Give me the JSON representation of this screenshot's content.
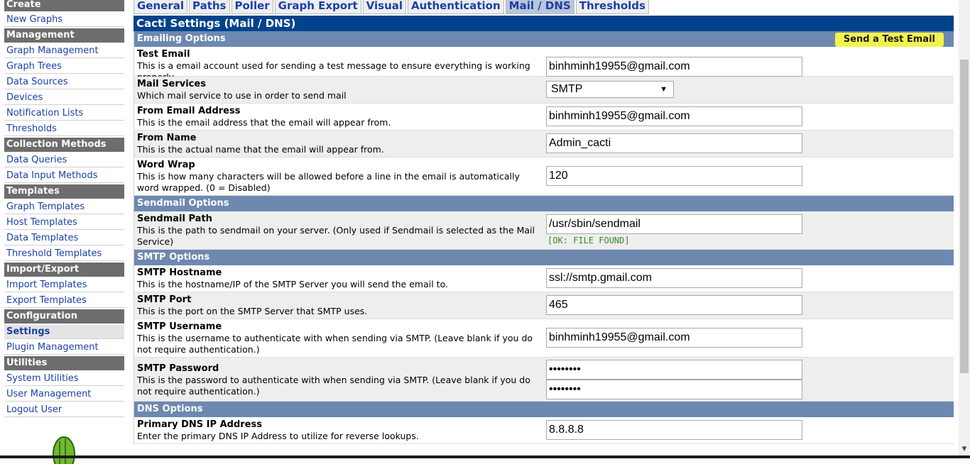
{
  "sidebar": {
    "create_label": "Create",
    "items": [
      {
        "type": "item",
        "label": "New Graphs"
      },
      {
        "type": "header",
        "label": "Management"
      },
      {
        "type": "item",
        "label": "Graph Management"
      },
      {
        "type": "item",
        "label": "Graph Trees"
      },
      {
        "type": "item",
        "label": "Data Sources"
      },
      {
        "type": "item",
        "label": "Devices"
      },
      {
        "type": "item",
        "label": "Notification Lists"
      },
      {
        "type": "item",
        "label": "Thresholds"
      },
      {
        "type": "header",
        "label": "Collection Methods"
      },
      {
        "type": "item",
        "label": "Data Queries"
      },
      {
        "type": "item",
        "label": "Data Input Methods"
      },
      {
        "type": "header",
        "label": "Templates"
      },
      {
        "type": "item",
        "label": "Graph Templates"
      },
      {
        "type": "item",
        "label": "Host Templates"
      },
      {
        "type": "item",
        "label": "Data Templates"
      },
      {
        "type": "item",
        "label": "Threshold Templates"
      },
      {
        "type": "header",
        "label": "Import/Export"
      },
      {
        "type": "item",
        "label": "Import Templates"
      },
      {
        "type": "item",
        "label": "Export Templates"
      },
      {
        "type": "header",
        "label": "Configuration"
      },
      {
        "type": "item",
        "label": "Settings",
        "selected": true
      },
      {
        "type": "item",
        "label": "Plugin Management"
      },
      {
        "type": "header",
        "label": "Utilities"
      },
      {
        "type": "item",
        "label": "System Utilities"
      },
      {
        "type": "item",
        "label": "User Management"
      },
      {
        "type": "item",
        "label": "Logout User"
      }
    ]
  },
  "tabs": [
    {
      "label": "General",
      "active": false
    },
    {
      "label": "Paths",
      "active": false
    },
    {
      "label": "Poller",
      "active": false
    },
    {
      "label": "Graph Export",
      "active": false
    },
    {
      "label": "Visual",
      "active": false
    },
    {
      "label": "Authentication",
      "active": false
    },
    {
      "label": "Mail / DNS",
      "active": true
    },
    {
      "label": "Thresholds",
      "active": false
    }
  ],
  "page_title": "Cacti Settings (Mail / DNS)",
  "sections": {
    "emailing": {
      "title": "Emailing Options",
      "test_button": "Send a Test Email"
    },
    "sendmail": {
      "title": "Sendmail Options"
    },
    "smtp": {
      "title": "SMTP Options"
    },
    "dns": {
      "title": "DNS Options"
    }
  },
  "fields": {
    "test_email": {
      "title": "Test Email",
      "desc": "This is a email account used for sending a test message to ensure everything is working properly.",
      "value": "binhminh19955@gmail.com"
    },
    "mail_services": {
      "title": "Mail Services",
      "desc": "Which mail service to use in order to send mail",
      "value": "SMTP"
    },
    "from_email": {
      "title": "From Email Address",
      "desc": "This is the email address that the email will appear from.",
      "value": "binhminh19955@gmail.com"
    },
    "from_name": {
      "title": "From Name",
      "desc": "This is the actual name that the email will appear from.",
      "value": "Admin_cacti"
    },
    "word_wrap": {
      "title": "Word Wrap",
      "desc": "This is how many characters will be allowed before a line in the email is automatically word wrapped. (0 = Disabled)",
      "value": "120"
    },
    "sendmail_path": {
      "title": "Sendmail Path",
      "desc": "This is the path to sendmail on your server. (Only used if Sendmail is selected as the Mail Service)",
      "value": "/usr/sbin/sendmail",
      "status": "[OK: FILE FOUND]"
    },
    "smtp_hostname": {
      "title": "SMTP Hostname",
      "desc": "This is the hostname/IP of the SMTP Server you will send the email to.",
      "value": "ssl://smtp.gmail.com"
    },
    "smtp_port": {
      "title": "SMTP Port",
      "desc": "This is the port on the SMTP Server that SMTP uses.",
      "value": "465"
    },
    "smtp_username": {
      "title": "SMTP Username",
      "desc": "This is the username to authenticate with when sending via SMTP. (Leave blank if you do not require authentication.)",
      "value": "binhminh19955@gmail.com"
    },
    "smtp_password": {
      "title": "SMTP Password",
      "desc": "This is the password to authenticate with when sending via SMTP. (Leave blank if you do not require authentication.)",
      "value": "••••••••",
      "confirm": "••••••••"
    },
    "primary_dns": {
      "title": "Primary DNS IP Address",
      "desc": "Enter the primary DNS IP Address to utilize for reverse lookups.",
      "value": "8.8.8.8"
    }
  }
}
